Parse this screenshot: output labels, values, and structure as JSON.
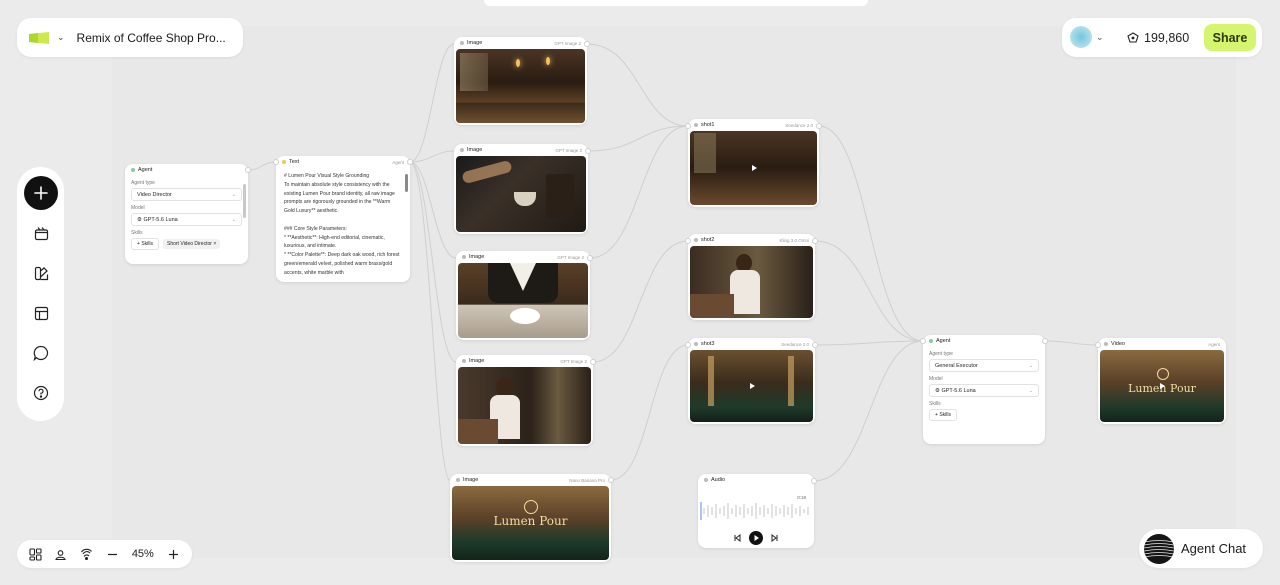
{
  "header": {
    "project_title": "Remix of Coffee Shop Pro...",
    "credits": "199,860",
    "share_label": "Share"
  },
  "zoom": {
    "level": "45%"
  },
  "agent_chat": {
    "label": "Agent Chat"
  },
  "nodes": {
    "agent1": {
      "title": "Agent",
      "agent_type_label": "Agent type",
      "agent_type": "Video Director",
      "model_label": "Model",
      "model": "GPT-5.6 Luna",
      "skills_label": "Skills",
      "skills_button": "Skills",
      "skill_tag": "Short Video Director"
    },
    "text1": {
      "title": "Text",
      "tag": "Agent",
      "body": "# Lumen Pour Visual Style Grounding\nTo maintain absolute style consistency with the existing Lumen Pour brand identity, all raw image prompts are rigorously grounded in the **Warm Gold Luxury** aesthetic.\n\n### Core Style Parameters:\n* **Aesthetic**: High-end editorial, cinematic, luxurious, and intimate.\n* **Color Palette**: Deep dark oak wood, rich forest green/emerald velvet, polished warm brass/gold accents, white marble with"
    },
    "image1": {
      "title": "Image",
      "model": "GPT Image 2"
    },
    "image2": {
      "title": "Image",
      "model": "GPT Image 2"
    },
    "image3": {
      "title": "Image",
      "model": "GPT Image 2"
    },
    "image4": {
      "title": "Image",
      "model": "GPT Image 2"
    },
    "image5": {
      "title": "Image",
      "model": "Nano Banana Pro"
    },
    "shot1": {
      "title": "shot1",
      "model": "Seedance 2.0"
    },
    "shot2": {
      "title": "shot2",
      "model": "Kling 3.0 Omni"
    },
    "shot3": {
      "title": "shot3",
      "model": "Seedance 2.0"
    },
    "audio": {
      "title": "Audio",
      "time": "0:18"
    },
    "agent2": {
      "title": "Agent",
      "agent_type_label": "Agent type",
      "agent_type": "General Executor",
      "model_label": "Model",
      "model": "GPT-5.6 Luna",
      "skills_label": "Skills",
      "skills_button": "Skills"
    },
    "video": {
      "title": "Video",
      "tag": "Agent"
    }
  },
  "images": {
    "image5_brand": "Lumen Pour",
    "video_brand": "Lumen Pour"
  },
  "colors": {
    "accent": "#d4f56d",
    "canvas": "#ebebeb",
    "node_dot": "#7fd0a0"
  },
  "icons": {
    "logo": "green-flag-logo",
    "sidebar": [
      "plus-icon",
      "clapper-icon",
      "palette-icon",
      "layout-icon",
      "chat-bubble-icon",
      "help-icon"
    ],
    "toolbar": [
      "grid-icon",
      "person-pin-icon",
      "hand-icon",
      "minus-icon",
      "plus-icon"
    ]
  }
}
